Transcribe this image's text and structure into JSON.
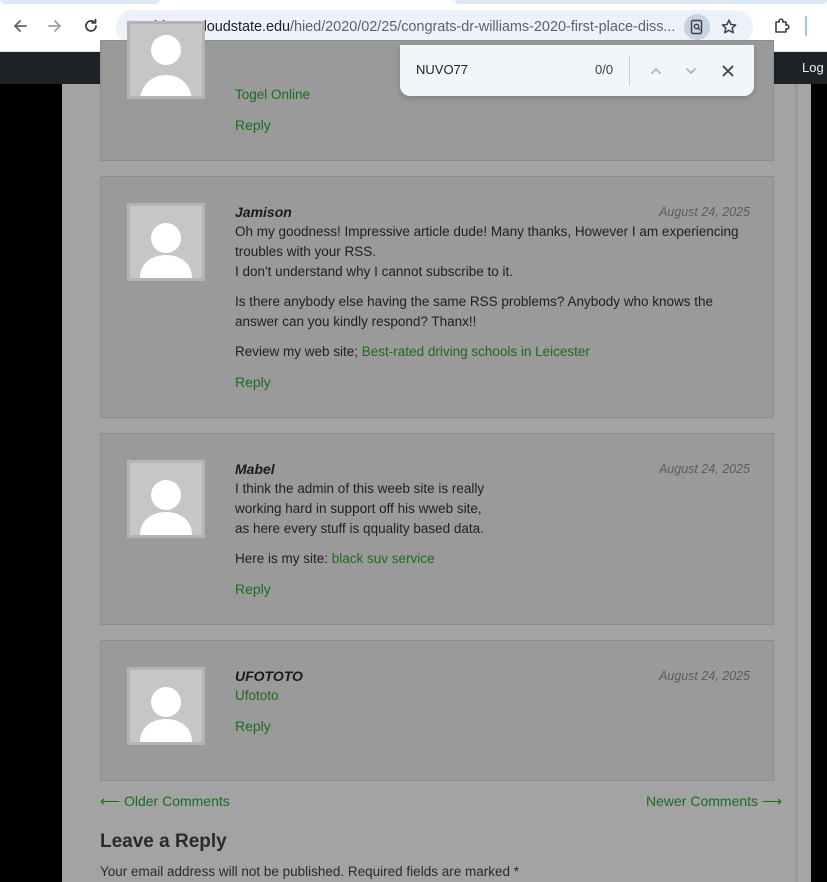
{
  "browser": {
    "url_host": "blog.stcloudstate.edu",
    "url_path": "/hied/2020/02/25/congrats-dr-williams-2020-first-place-diss..."
  },
  "admin_bar": {
    "login_label": "Log"
  },
  "find_bar": {
    "query": "NUVO77",
    "count": "0/0"
  },
  "comments": [
    {
      "partial": true,
      "link": "Togel Online",
      "reply_label": "Reply"
    },
    {
      "author": "Jamison",
      "date": "August 24, 2025",
      "p1_line1": "Oh my goodness! Impressive article dude! Many thanks, However I am experiencing troubles with your RSS.",
      "p1_line2": "I don't understand why I cannot subscribe to it.",
      "p2": "Is there anybody else having the same RSS problems? Anybody who knows the answer can you kindly respond? Thanx!!",
      "p3_prefix": "Review my web site; ",
      "p3_link": "Best-rated driving schools in Leicester",
      "reply_label": "Reply"
    },
    {
      "author": "Mabel",
      "date": "August 24, 2025",
      "line1": "I think the admin of this weeb site is really",
      "line2": "working hard in support off his wweb site,",
      "line3": "as here every stuff is qquality based data.",
      "p2_prefix": "Here is my site: ",
      "p2_link": "black suv service",
      "reply_label": "Reply"
    },
    {
      "author": "UFOTOTO",
      "date": "August 24, 2025",
      "link": "Ufototo",
      "reply_label": "Reply"
    }
  ],
  "pagination": {
    "older": "⟵ Older Comments",
    "newer": "Newer Comments ⟶"
  },
  "reply_form": {
    "heading": "Leave a Reply",
    "notes": "Your email address will not be published. Required fields are marked *"
  },
  "colors": {
    "link_green": "#1c6b1c",
    "page_bg": "#a3a3a3",
    "comment_bg": "#9a9a9a",
    "admin_bar": "#1d2327"
  }
}
